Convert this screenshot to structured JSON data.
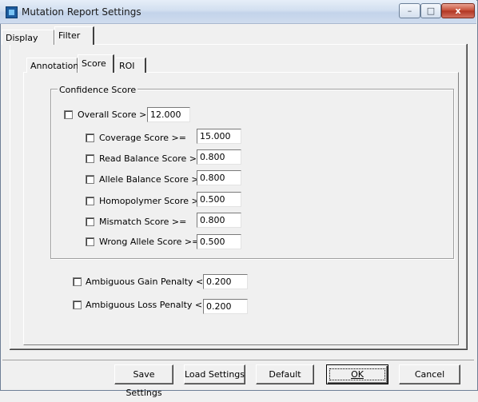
{
  "window": {
    "title": "Mutation Report Settings"
  },
  "caption_buttons": {
    "minimize": "–",
    "maximize": "□",
    "close": "x"
  },
  "outer_tabs": [
    {
      "label": "Display",
      "selected": false
    },
    {
      "label": "Filter",
      "selected": true
    }
  ],
  "inner_tabs": [
    {
      "label": "Annotation",
      "selected": false
    },
    {
      "label": "Score",
      "selected": true
    },
    {
      "label": "ROI",
      "selected": false
    }
  ],
  "confidence": {
    "group_title": "Confidence Score",
    "overall": {
      "label": "Overall Score >=",
      "value": "12.000",
      "checked": false
    },
    "items": [
      {
        "label": "Coverage Score >=",
        "value": "15.000",
        "checked": false
      },
      {
        "label": "Read Balance Score >=",
        "value": "0.800",
        "checked": false
      },
      {
        "label": "Allele Balance Score >=",
        "value": "0.800",
        "checked": false
      },
      {
        "label": "Homopolymer Score >=",
        "value": "0.500",
        "checked": false
      },
      {
        "label": "Mismatch Score >=",
        "value": "0.800",
        "checked": false
      },
      {
        "label": "Wrong Allele Score >=",
        "value": "0.500",
        "checked": false
      }
    ]
  },
  "penalties": [
    {
      "label": "Ambiguous Gain Penalty <=",
      "value": "0.200",
      "checked": false
    },
    {
      "label": "Ambiguous Loss Penalty <=",
      "value": "0.200",
      "checked": false
    }
  ],
  "buttons": {
    "save": "Save Settings",
    "load": "Load Settings",
    "default": "Default",
    "ok": "OK",
    "cancel": "Cancel"
  }
}
